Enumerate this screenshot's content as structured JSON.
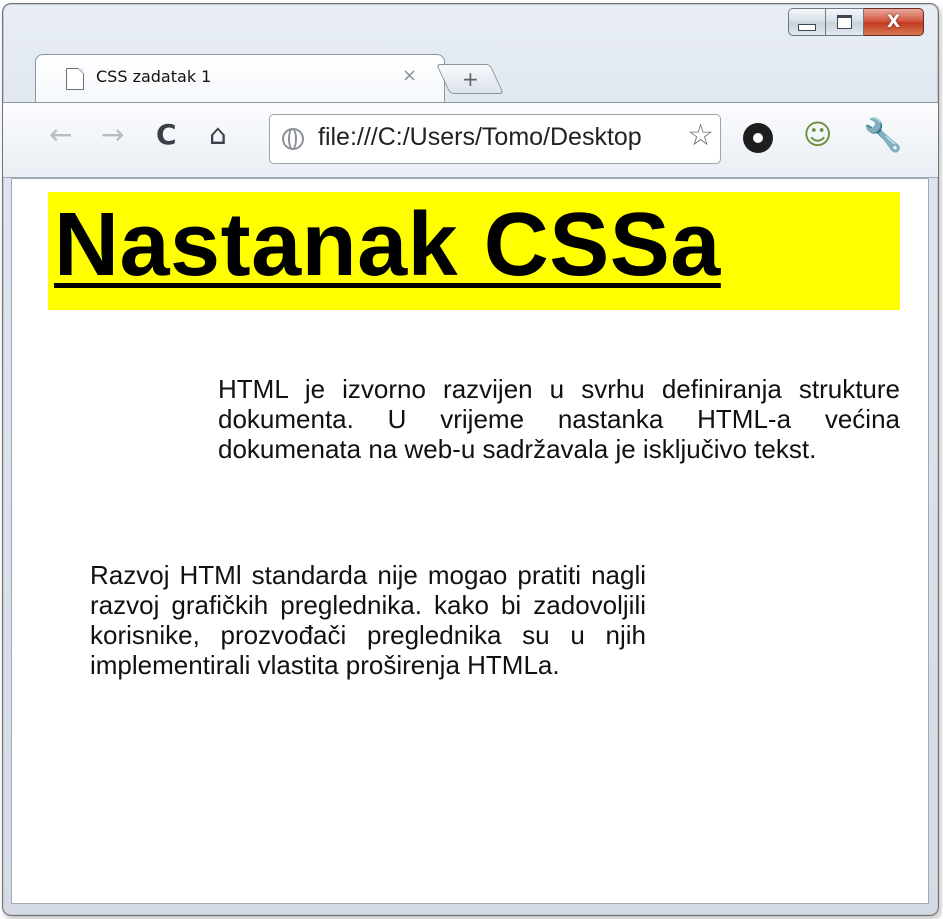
{
  "browser": {
    "tab": {
      "title": "CSS zadatak 1",
      "close_glyph": "×"
    },
    "new_tab_glyph": "+",
    "caption": {
      "minimize_icon": "minimize-icon",
      "maximize_icon": "maximize-icon",
      "close_glyph": "X"
    },
    "toolbar": {
      "back_glyph": "←",
      "forward_glyph": "→",
      "reload_glyph": "C",
      "home_glyph": "⌂",
      "url": "file:///C:/Users/Tomo/Desktop",
      "star_glyph": "☆",
      "chat_glyph": "☺",
      "wrench_glyph": "🔧"
    }
  },
  "page": {
    "heading": "Nastanak CSSa",
    "heading_bg": "#ffff00",
    "paragraphs": [
      "HTML je izvorno razvijen u svrhu definiranja strukture dokumenta. U vrijeme nastanka HTML-a većina dokumenata na web-u sadržavala je isključivo tekst.",
      "Razvoj HTMl standarda nije mogao pratiti nagli razvoj grafičkih preglednika. kako bi zadovoljili korisnike, prozvođači preglednika su u njih implementirali vlastita proširenja HTMLa."
    ]
  }
}
